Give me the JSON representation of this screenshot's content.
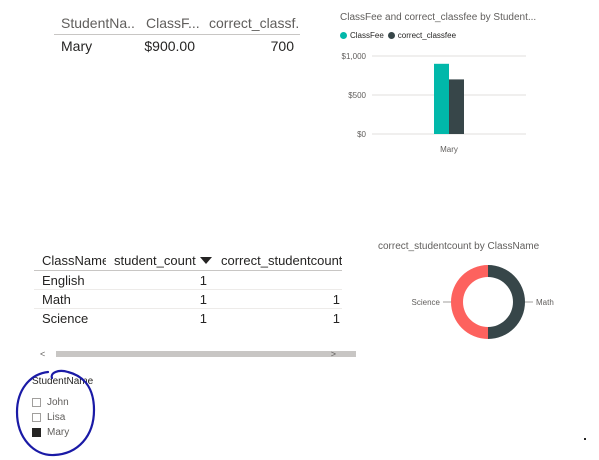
{
  "table1": {
    "headers": [
      "StudentNa...",
      "ClassF...",
      "correct_classf..."
    ],
    "rows": [
      [
        "Mary",
        "$900.00",
        "700"
      ]
    ]
  },
  "bar_chart": {
    "title": "ClassFee and correct_classfee by Student...",
    "legend": [
      {
        "name": "ClassFee",
        "color": "#01b8aa"
      },
      {
        "name": "correct_classfee",
        "color": "#374649"
      }
    ]
  },
  "table2": {
    "headers": [
      "ClassName",
      "student_count",
      "correct_studentcount"
    ],
    "sort_icon": "sort-descending-icon",
    "rows": [
      [
        "English",
        "1",
        ""
      ],
      [
        "Math",
        "1",
        "1"
      ],
      [
        "Science",
        "1",
        "1"
      ]
    ],
    "scroll_left_icon": "<",
    "scroll_right_icon": ">"
  },
  "donut_chart": {
    "title": "correct_studentcount by ClassName"
  },
  "slicer": {
    "title": "StudentName",
    "items": [
      {
        "label": "John",
        "checked": false
      },
      {
        "label": "Lisa",
        "checked": false
      },
      {
        "label": "Mary",
        "checked": true
      }
    ]
  },
  "annotation": {
    "color": "#1a1aa6",
    "shape": "hand-drawn-circle"
  },
  "chart_data": [
    {
      "type": "bar",
      "title": "ClassFee and correct_classfee by Student...",
      "categories": [
        "Mary"
      ],
      "series": [
        {
          "name": "ClassFee",
          "values": [
            900
          ],
          "color": "#01b8aa"
        },
        {
          "name": "correct_classfee",
          "values": [
            700
          ],
          "color": "#374649"
        }
      ],
      "yticks": [
        "$1,000",
        "$500",
        "$0"
      ],
      "ylim": [
        0,
        1000
      ],
      "grid": true,
      "legend_position": "top-left"
    },
    {
      "type": "pie",
      "donut": true,
      "title": "correct_studentcount by ClassName",
      "slices": [
        {
          "label": "Math",
          "value": 1,
          "color": "#374649"
        },
        {
          "label": "Science",
          "value": 1,
          "color": "#fd625e"
        }
      ]
    }
  ]
}
